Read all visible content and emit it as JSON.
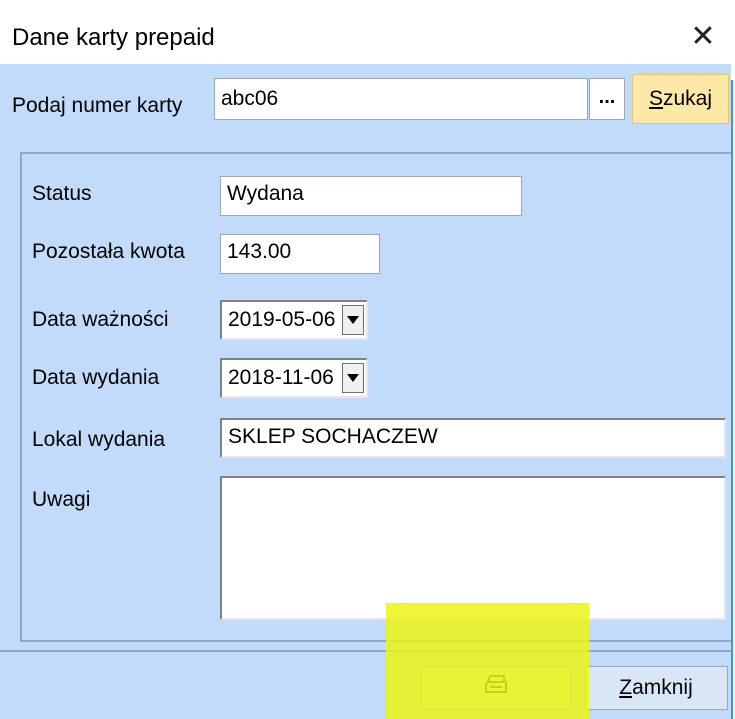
{
  "window": {
    "title": "Dane karty prepaid",
    "close_glyph": "✕"
  },
  "search": {
    "label": "Podaj numer karty",
    "value": "abc06",
    "browse_label": "...",
    "search_button_accel": "S",
    "search_button_rest": "zukaj"
  },
  "fields": {
    "status": {
      "label": "Status",
      "value": "Wydana"
    },
    "remaining": {
      "label": "Pozostała kwota",
      "value": "143.00"
    },
    "expiry": {
      "label": "Data ważności",
      "value": "2019-05-06"
    },
    "issue_date": {
      "label": "Data wydania",
      "value": "2018-11-06"
    },
    "issue_place": {
      "label": "Lokal wydania",
      "value": "SKLEP SOCHACZEW"
    },
    "notes": {
      "label": "Uwagi",
      "value": ""
    }
  },
  "buttons": {
    "print_icon": "printer-icon",
    "close_accel": "Z",
    "close_rest": "amknij"
  },
  "colors": {
    "client_bg": "#c3dbfb",
    "search_button_bg": "#fde8a8",
    "highlight": "#ebf514",
    "window_border": "#3b9bd8"
  }
}
